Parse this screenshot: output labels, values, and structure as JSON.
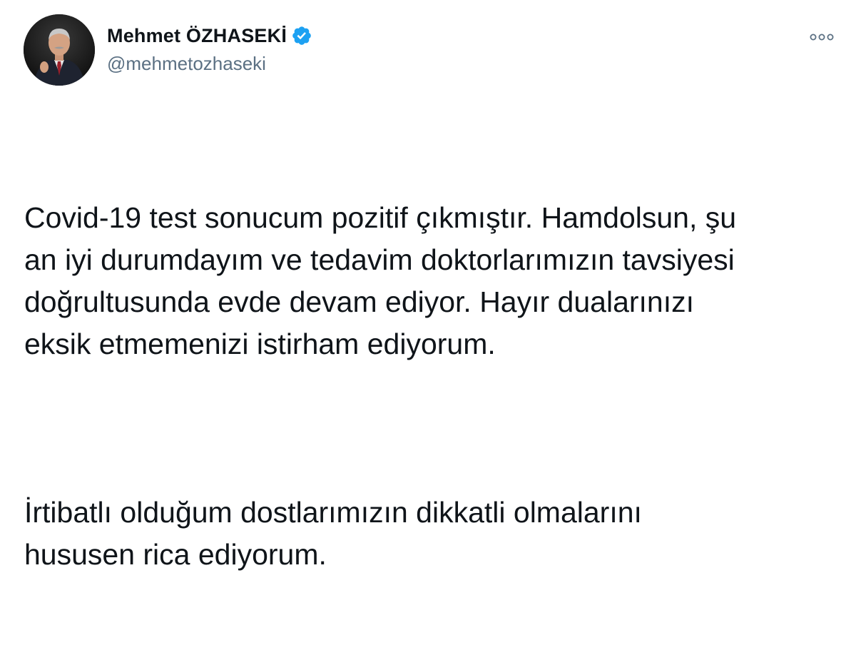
{
  "author": {
    "display_name": "Mehmet ÖZHASEKİ",
    "handle": "@mehmetozhaseki",
    "verified": true,
    "avatar_icon": "profile-photo",
    "verified_icon": "verified-badge-icon",
    "verified_color": "#1da1f2"
  },
  "menu": {
    "icon": "more-options-icon"
  },
  "tweet": {
    "paragraphs": [
      "Covid-19 test sonucum pozitif çıkmıştır. Hamdolsun, şu\nan iyi durumdayım ve tedavim doktorlarımızın tavsiyesi\ndoğrultusunda evde devam ediyor. Hayır dualarınızı\neksik etmemenizi istirham ediyorum.",
      "İrtibatlı olduğum dostlarımızın dikkatli olmalarını\nhususen rica ediyorum."
    ]
  },
  "colors": {
    "text": "#0f1419",
    "secondary": "#5b7083",
    "accent": "#1da1f2",
    "background": "#ffffff"
  }
}
